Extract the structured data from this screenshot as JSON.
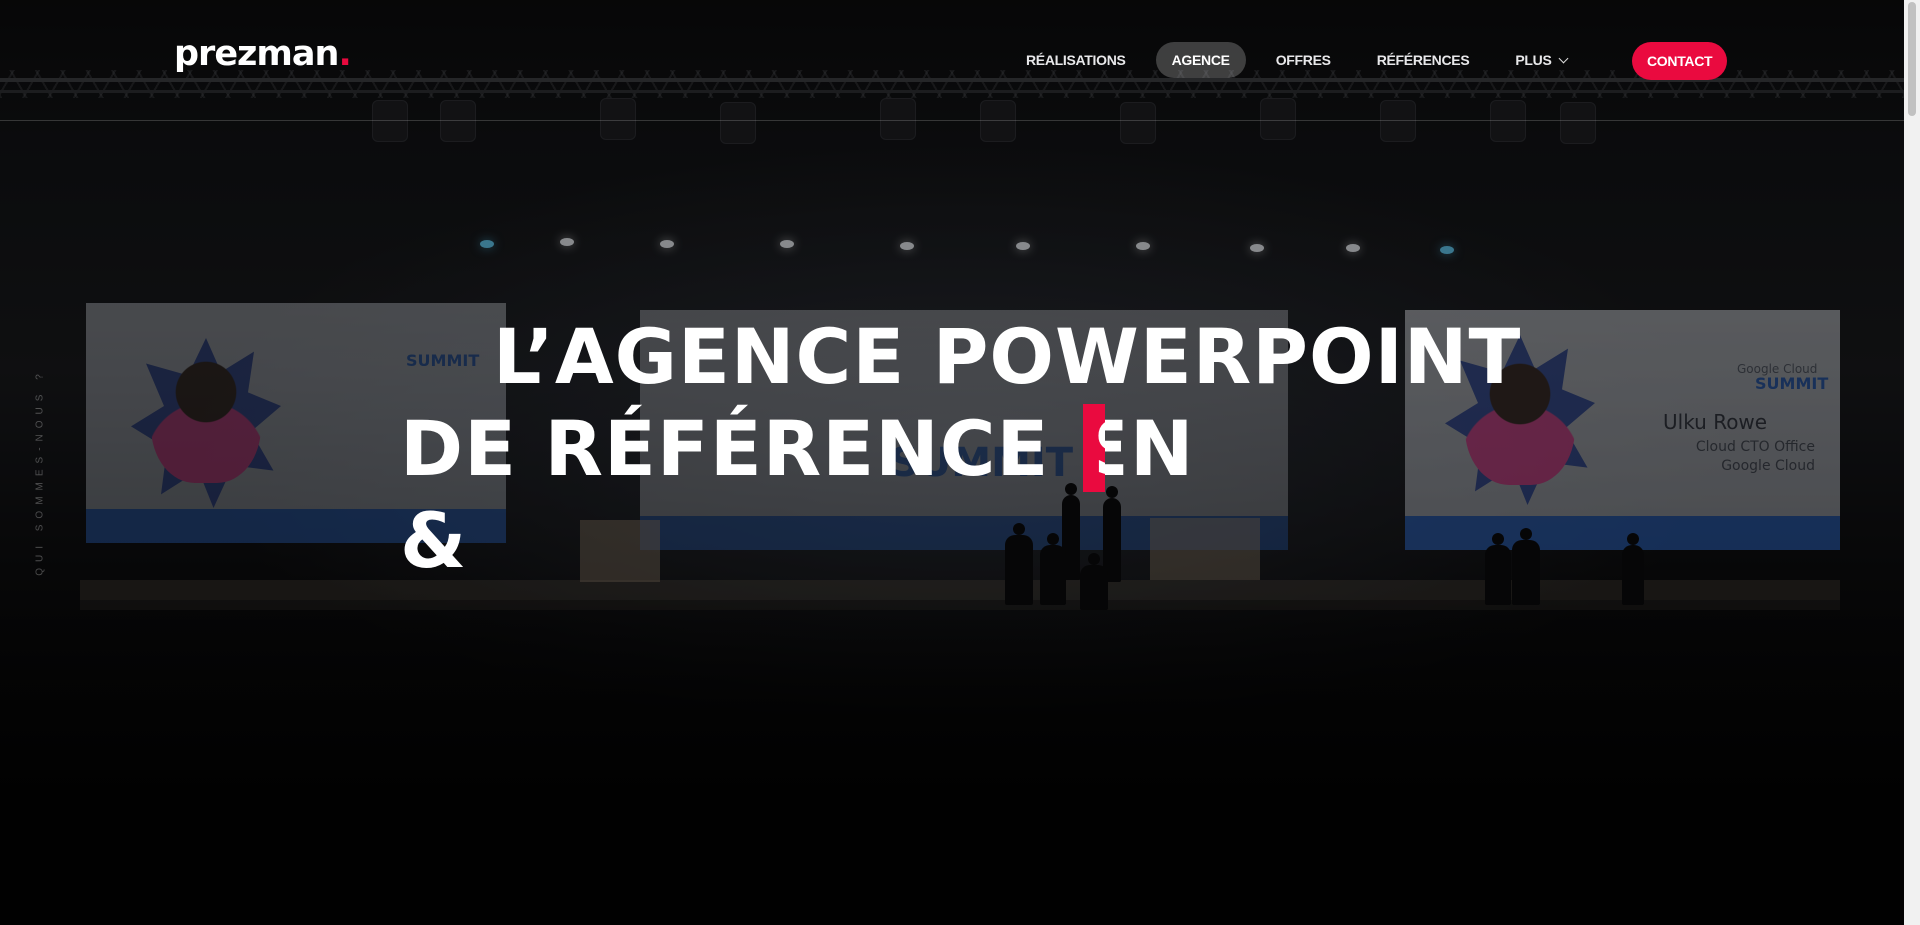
{
  "brand": {
    "logo_text": "prezman",
    "logo_dot": "."
  },
  "nav": {
    "items": [
      {
        "label": "RÉALISATIONS"
      },
      {
        "label": "AGENCE"
      },
      {
        "label": "OFFRES"
      },
      {
        "label": "RÉFÉRENCES"
      },
      {
        "label": "PLUS"
      }
    ],
    "active": "AGENCE",
    "contact_label": "CONTACT"
  },
  "side_label": "QUI SOMMES-NOUS ?",
  "hero": {
    "line1": "L’AGENCE POWERPOINT",
    "line2": "DE RÉFÉRENCE EN",
    "line3": "&",
    "typing_char": "S"
  },
  "stage": {
    "summit_label": "SUMMIT",
    "google_cloud_label": "Google Cloud",
    "speaker_name": "Ulku Rowe",
    "speaker_role_1": "Cloud CTO Office",
    "speaker_role_2": "Google Cloud"
  },
  "colors": {
    "accent": "#ea0a3f",
    "text": "#ffffff",
    "background": "#050505"
  },
  "icons": {
    "dropdown": "chevron-down-icon"
  }
}
